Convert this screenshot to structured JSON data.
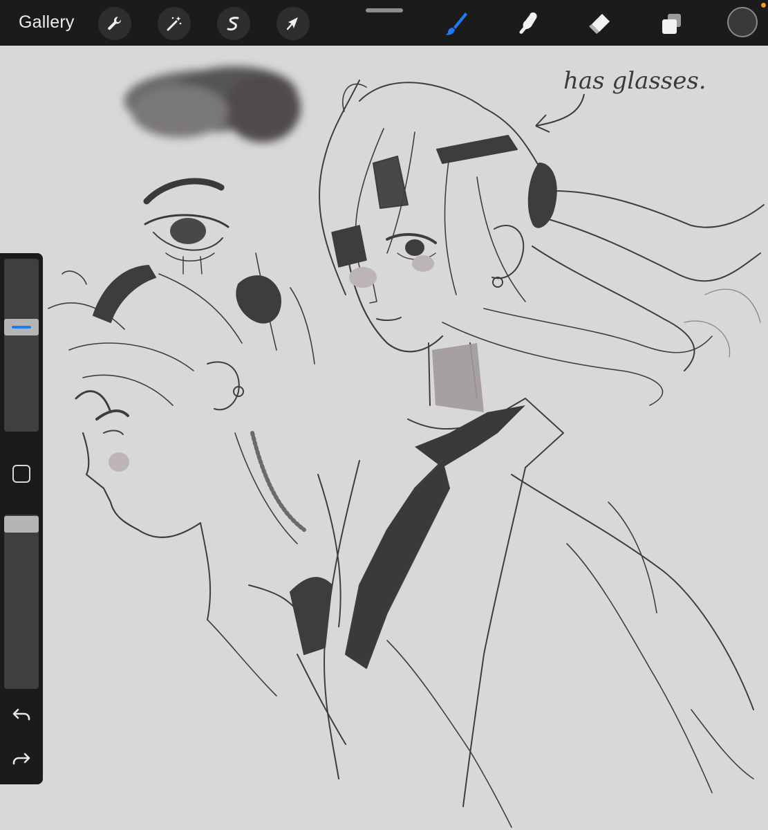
{
  "toolbar": {
    "gallery_label": "Gallery",
    "left_tools": [
      {
        "name": "actions",
        "icon": "wrench-icon"
      },
      {
        "name": "adjustments",
        "icon": "magic-wand-icon"
      },
      {
        "name": "selection",
        "icon": "selection-s-icon"
      },
      {
        "name": "transform",
        "icon": "arrow-cursor-icon"
      }
    ],
    "right_tools": [
      {
        "name": "brush",
        "icon": "brush-icon",
        "active": true
      },
      {
        "name": "smudge",
        "icon": "smudge-finger-icon",
        "active": false
      },
      {
        "name": "eraser",
        "icon": "eraser-icon",
        "active": false
      },
      {
        "name": "layers",
        "icon": "layers-icon",
        "active": false
      }
    ],
    "current_color": "#3b3839"
  },
  "colors": {
    "toolbar_bg": "#1b1b1c",
    "canvas_bg": "#d8d8d8",
    "accent_blue": "#1e7cf2",
    "status_orange": "#f29a1b",
    "ink": "#3a3a3a"
  },
  "sidebar": {
    "brush_size_level": 0.63,
    "brush_opacity_level": 1.0,
    "modify_icon": "square-outline-icon",
    "undo_icon": "undo-arrow-icon",
    "redo_icon": "redo-arrow-icon"
  },
  "canvas": {
    "annotation_text": "has glasses."
  }
}
